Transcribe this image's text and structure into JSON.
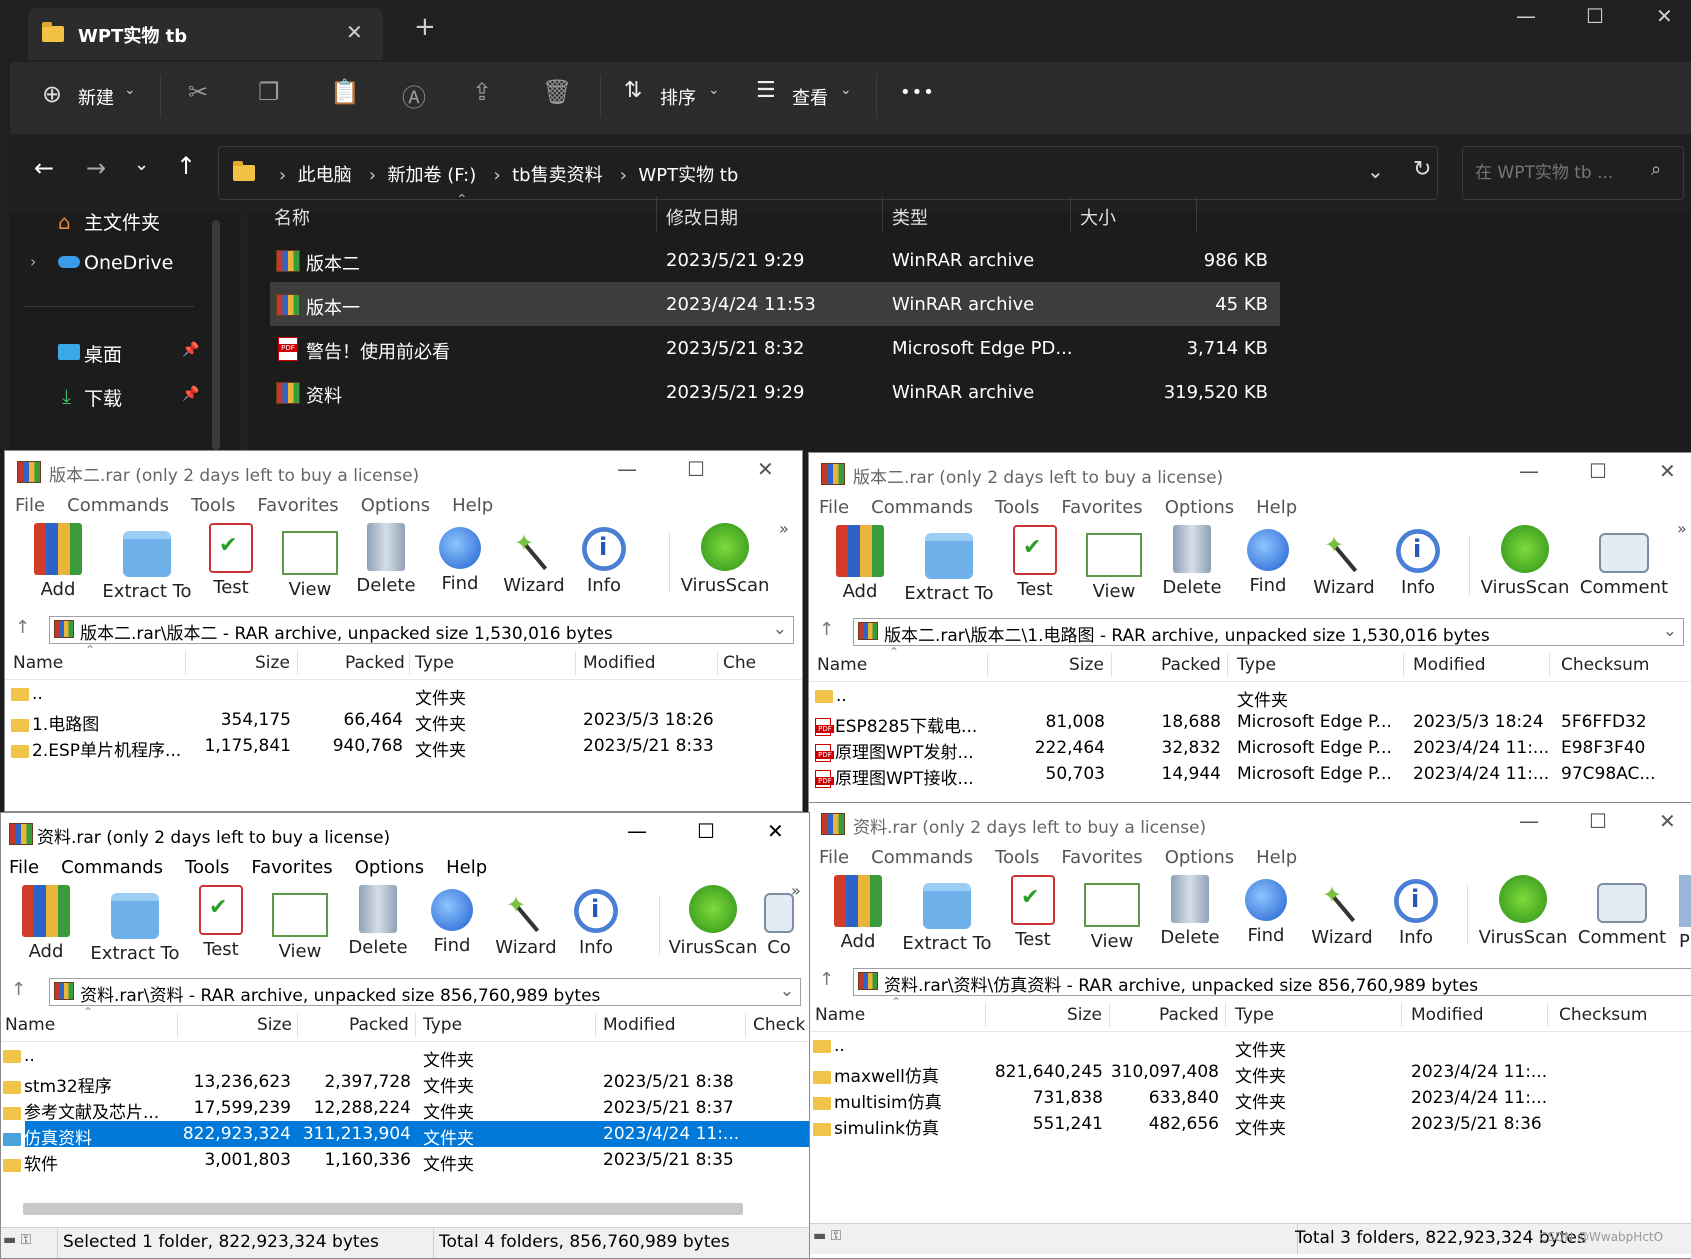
{
  "explorer": {
    "tab_title": "WPT实物 tb",
    "new_tab": "+",
    "window_controls": {
      "minimize": "—",
      "maximize": "☐",
      "close": "✕"
    },
    "toolbar": {
      "new_label": "新建",
      "sort_label": "排序",
      "view_label": "查看",
      "more": "•••"
    },
    "breadcrumb": [
      "此电脑",
      "新加卷 (F:)",
      "tb售卖资料",
      "WPT实物 tb"
    ],
    "search_placeholder": "在 WPT实物 tb ...",
    "sidebar": {
      "home": "主文件夹",
      "onedrive": "OneDrive",
      "desktop": "桌面",
      "downloads": "下载"
    },
    "columns": {
      "name": "名称",
      "modified": "修改日期",
      "type": "类型",
      "size": "大小"
    },
    "files": [
      {
        "name": "版本二",
        "modified": "2023/5/21 9:29",
        "type": "WinRAR archive",
        "size": "986 KB",
        "icon": "rar"
      },
      {
        "name": "版本一",
        "modified": "2023/4/24 11:53",
        "type": "WinRAR archive",
        "size": "45 KB",
        "icon": "rar"
      },
      {
        "name": "警告！使用前必看",
        "modified": "2023/5/21 8:32",
        "type": "Microsoft Edge PD...",
        "size": "3,714 KB",
        "icon": "pdf"
      },
      {
        "name": "资料",
        "modified": "2023/5/21 9:29",
        "type": "WinRAR archive",
        "size": "319,520 KB",
        "icon": "rar"
      }
    ]
  },
  "rar_common": {
    "menu": [
      "File",
      "Commands",
      "Tools",
      "Favorites",
      "Options",
      "Help"
    ],
    "tools": {
      "add": "Add",
      "extract": "Extract To",
      "test": "Test",
      "view": "View",
      "delete": "Delete",
      "find": "Find",
      "wizard": "Wizard",
      "info": "Info",
      "virus": "VirusScan",
      "comment": "Comment",
      "co": "Co",
      "pr": "Pr",
      "more": "»"
    },
    "cols": {
      "name": "Name",
      "size": "Size",
      "packed": "Packed",
      "type": "Type",
      "modified": "Modified",
      "checksum": "Checksum",
      "che": "Che",
      "check": "Check"
    }
  },
  "win1": {
    "title": "版本二.rar (only 2 days left to buy a license)",
    "path": "版本二.rar\\版本二 - RAR archive, unpacked size 1,530,016 bytes",
    "rows": [
      {
        "name": "..",
        "size": "",
        "packed": "",
        "type": "文件夹",
        "modified": ""
      },
      {
        "name": "1.电路图",
        "size": "354,175",
        "packed": "66,464",
        "type": "文件夹",
        "modified": "2023/5/3 18:26"
      },
      {
        "name": "2.ESP单片机程序...",
        "size": "1,175,841",
        "packed": "940,768",
        "type": "文件夹",
        "modified": "2023/5/21 8:33"
      }
    ]
  },
  "win2": {
    "title": "版本二.rar (only 2 days left to buy a license)",
    "path": "版本二.rar\\版本二\\1.电路图 - RAR archive, unpacked size 1,530,016 bytes",
    "rows": [
      {
        "name": "..",
        "size": "",
        "packed": "",
        "type": "文件夹",
        "modified": "",
        "checksum": ""
      },
      {
        "name": "ESP8285下载电...",
        "size": "81,008",
        "packed": "18,688",
        "type": "Microsoft Edge P...",
        "modified": "2023/5/3 18:24",
        "checksum": "5F6FFD32"
      },
      {
        "name": "原理图WPT发射...",
        "size": "222,464",
        "packed": "32,832",
        "type": "Microsoft Edge P...",
        "modified": "2023/4/24 11:...",
        "checksum": "E98F3F40"
      },
      {
        "name": "原理图WPT接收...",
        "size": "50,703",
        "packed": "14,944",
        "type": "Microsoft Edge P...",
        "modified": "2023/4/24 11:...",
        "checksum": "97C98AC..."
      }
    ]
  },
  "win3": {
    "title": "资料.rar (only 2 days left to buy a license)",
    "path": "资料.rar\\资料 - RAR archive, unpacked size 856,760,989 bytes",
    "rows": [
      {
        "name": "..",
        "size": "",
        "packed": "",
        "type": "文件夹",
        "modified": ""
      },
      {
        "name": "stm32程序",
        "size": "13,236,623",
        "packed": "2,397,728",
        "type": "文件夹",
        "modified": "2023/5/21 8:38"
      },
      {
        "name": "参考文献及芯片...",
        "size": "17,599,239",
        "packed": "12,288,224",
        "type": "文件夹",
        "modified": "2023/5/21 8:37"
      },
      {
        "name": "仿真资料",
        "size": "822,923,324",
        "packed": "311,213,904",
        "type": "文件夹",
        "modified": "2023/4/24 11:..."
      },
      {
        "name": "软件",
        "size": "3,001,803",
        "packed": "1,160,336",
        "type": "文件夹",
        "modified": "2023/5/21 8:35"
      }
    ],
    "status_left": "Selected 1 folder, 822,923,324 bytes",
    "status_right": "Total 4 folders, 856,760,989 bytes"
  },
  "win4": {
    "title": "资料.rar (only 2 days left to buy a license)",
    "path": "资料.rar\\资料\\仿真资料 - RAR archive, unpacked size 856,760,989 bytes",
    "rows": [
      {
        "name": "..",
        "size": "",
        "packed": "",
        "type": "文件夹",
        "modified": ""
      },
      {
        "name": "maxwell仿真",
        "size": "821,640,245",
        "packed": "310,097,408",
        "type": "文件夹",
        "modified": "2023/4/24 11:..."
      },
      {
        "name": "multisim仿真",
        "size": "731,838",
        "packed": "633,840",
        "type": "文件夹",
        "modified": "2023/4/24 11:..."
      },
      {
        "name": "simulink仿真",
        "size": "551,241",
        "packed": "482,656",
        "type": "文件夹",
        "modified": "2023/5/21 8:36"
      }
    ],
    "status_right": "Total 3 folders, 822,923,324 bytes",
    "watermark": "CSDN @WwabpHctO"
  }
}
